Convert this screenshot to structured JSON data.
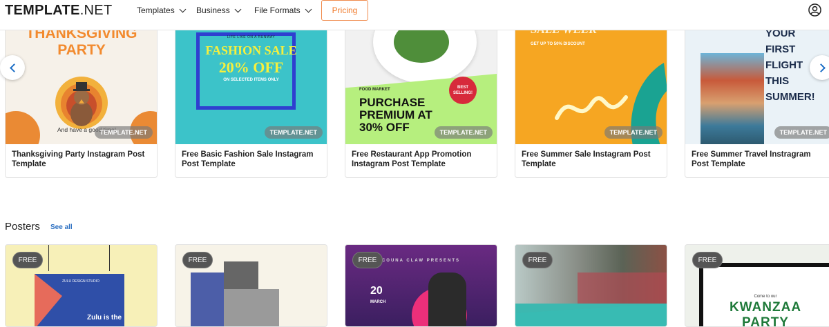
{
  "header": {
    "logo_main": "TEMPLATE",
    "logo_suffix": ".NET",
    "nav": [
      {
        "label": "Templates"
      },
      {
        "label": "Business"
      },
      {
        "label": "File Formats"
      }
    ],
    "pricing_label": "Pricing",
    "user_icon": "user-circle-icon"
  },
  "instagram_cards": [
    {
      "title": "Thanksgiving Party Instagram Post Template",
      "thumb_heading": "THANKSGIVING PARTY",
      "thumb_footer": "And have a good time!",
      "badge": "TEMPLATE.NET"
    },
    {
      "title": "Free Basic Fashion Sale Instagram Post Template",
      "thumb_kicker": "LIFE LIKE ON A RUNWAY",
      "thumb_line1": "FASHION SALE",
      "thumb_line2": "20% OFF",
      "thumb_sub": "ON SELECTED ITEMS ONLY",
      "badge": "TEMPLATE.NET"
    },
    {
      "title": "Free Restaurant App Promotion Instagram Post Template",
      "thumb_kicker": "FOOD MARKET",
      "thumb_line1": "PURCHASE",
      "thumb_line2": "PREMIUM AT",
      "thumb_line3": "30% OFF",
      "thumb_sticker": "BEST SELLING!",
      "badge": "TEMPLATE.NET"
    },
    {
      "title": "Free Summer Sale Instagram Post Template",
      "thumb_heading": "SALE WEEK",
      "thumb_sub": "GET UP TO 50% DISCOUNT",
      "badge": "TEMPLATE.NET"
    },
    {
      "title": "Free Summer Travel Instragram Post Template",
      "thumb_line1": "YOUR",
      "thumb_line2": "FIRST",
      "thumb_line3": "FLIGHT",
      "thumb_line4": "THIS",
      "thumb_line5": "SUMMER!",
      "badge": "TEMPLATE.NET"
    }
  ],
  "posters_section": {
    "title": "Posters",
    "see_all": "See all",
    "items": [
      {
        "badge": "FREE",
        "thumb_text1": "ZULU DESIGN STUDIO",
        "thumb_text2": "Zulu is the"
      },
      {
        "badge": "FREE"
      },
      {
        "badge": "FREE",
        "thumb_text1": "COUNA CLAW PRESENTS",
        "thumb_text2": "20",
        "thumb_text3": "MARCH"
      },
      {
        "badge": "FREE"
      },
      {
        "badge": "FREE",
        "thumb_text1": "Come to our",
        "thumb_text2": "KWANZAA",
        "thumb_text3": "PARTY"
      }
    ]
  },
  "colors": {
    "accent_orange": "#f07a2b",
    "link_blue": "#2b6fc1",
    "teal": "#3cc3c9",
    "lime": "#b6ef7e",
    "yellow_orange": "#f6a622"
  }
}
